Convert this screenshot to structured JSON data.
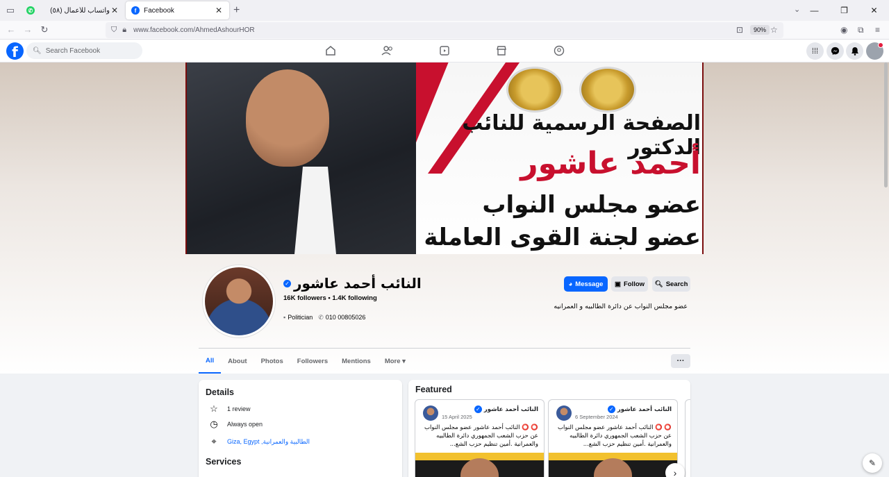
{
  "browser": {
    "tabs": [
      {
        "title": "واتساب للأعمال (٥٨)",
        "favicon": "whatsapp-icon",
        "color": "#25d366"
      },
      {
        "title": "Facebook",
        "favicon": "facebook-icon",
        "color": "#0866ff"
      }
    ],
    "url": "www.facebook.com/AhmedAshourHOR",
    "zoom": "90%",
    "new_tab": "+",
    "close_glyph": "✕"
  },
  "fb": {
    "logo": "f",
    "search_placeholder": "Search Facebook",
    "nav_icons": [
      "home-icon",
      "friends-icon",
      "video-icon",
      "marketplace-icon",
      "groups-icon"
    ],
    "right_icons": [
      "menu-grid-icon",
      "messenger-icon",
      "notifications-icon",
      "account-icon"
    ]
  },
  "cover": {
    "line1": "الصفحة الرسمية للنائب الدكتور",
    "line2": "أحمد عاشور",
    "line3": "عضو مجلس النواب",
    "line4": "عضو لجنة القوى العاملة"
  },
  "profile": {
    "name": "النائب أحمد عاشور",
    "stats": "16K followers • 1.4K following",
    "category": "Politician",
    "phone": "010 00805026",
    "bio": "عضو مجلس النواب عن دائرة الطالبيه و العمرانيه",
    "buttons": {
      "message": "Message",
      "follow": "Follow",
      "search": "Search"
    },
    "tabs": [
      "All",
      "About",
      "Photos",
      "Followers",
      "Mentions",
      "More ▾"
    ],
    "more_dots": "···"
  },
  "details": {
    "title": "Details",
    "review": "1 review",
    "hours": "Always open",
    "location": "Giza, Egypt ,الطالبية والعمرانية",
    "services_title": "Services"
  },
  "featured": {
    "title": "Featured",
    "cards": [
      {
        "author": "النائب أحمد عاشور",
        "date": "15 April 2025",
        "text": "⭕ ⭕ النائب أحمد عاشور عضو مجلس النواب عن حزب الشعب الجمهوري دائرة الطالبيه والعمرانية .أمين تنظيم حزب الشع..."
      },
      {
        "author": "النائب أحمد عاشور",
        "date": "6 September 2024",
        "text": "⭕ ⭕ النائب أحمد عاشور عضو مجلس النواب عن حزب الشعب الجمهوري دائرة الطالبيه والعمرانية .أمين تنظيم حزب الشع..."
      }
    ],
    "next": "›"
  }
}
